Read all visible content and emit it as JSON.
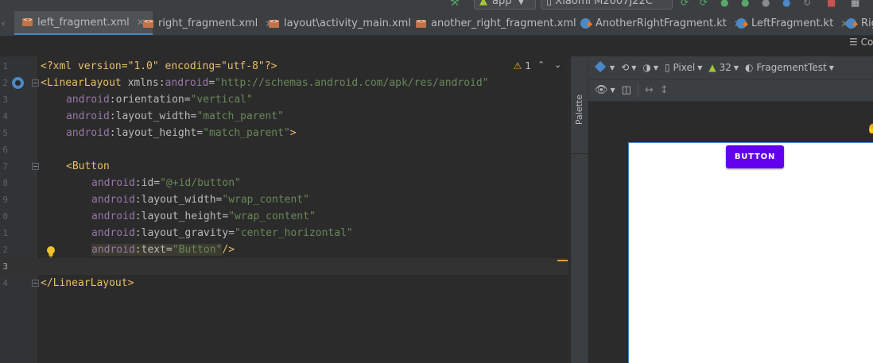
{
  "toolbar": {
    "run_config": "app",
    "device": "Xiaomi M2007J22C"
  },
  "tabs": [
    {
      "label": "left_fragment.xml",
      "type": "xml",
      "active": true
    },
    {
      "label": "right_fragment.xml",
      "type": "xml",
      "active": false
    },
    {
      "label": "layout\\activity_main.xml",
      "type": "xml",
      "active": false
    },
    {
      "label": "another_right_fragment.xml",
      "type": "xml",
      "active": false
    },
    {
      "label": "AnotherRightFragment.kt",
      "type": "kotlin",
      "active": false
    },
    {
      "label": "LeftFragment.kt",
      "type": "kotlin",
      "active": false
    },
    {
      "label": "Rig",
      "type": "kotlin",
      "active": false
    }
  ],
  "editor": {
    "warnings_count": "1",
    "lines": [
      {
        "num": "1"
      },
      {
        "num": "2"
      },
      {
        "num": "3"
      },
      {
        "num": "4"
      },
      {
        "num": "5"
      },
      {
        "num": "6"
      },
      {
        "num": "7"
      },
      {
        "num": "8"
      },
      {
        "num": "9"
      },
      {
        "num": "0"
      },
      {
        "num": "1"
      },
      {
        "num": "2"
      },
      {
        "num": "3"
      },
      {
        "num": "4"
      }
    ],
    "code": {
      "l1_pi": "<?xml version=\"1.0\" encoding=\"utf-8\"?>",
      "l2_tag": "<LinearLayout",
      "l2_attr": " xmlns:",
      "l2_ns": "android",
      "l2_eq": "=",
      "l2_val": "\"http://schemas.android.com/apk/res/android\"",
      "l3_ns": "android",
      "l3_attr": ":orientation=",
      "l3_val": "\"vertical\"",
      "l4_ns": "android",
      "l4_attr": ":layout_width=",
      "l4_val": "\"match_parent\"",
      "l5_ns": "android",
      "l5_attr": ":layout_height=",
      "l5_val": "\"match_parent\"",
      "l5_end": ">",
      "l7_tag": "<Button",
      "l8_ns": "android",
      "l8_attr": ":id=",
      "l8_val": "\"@+id/button\"",
      "l9_ns": "android",
      "l9_attr": ":layout_width=",
      "l9_val": "\"wrap_content\"",
      "l10_ns": "android",
      "l10_attr": ":layout_height=",
      "l10_val": "\"wrap_content\"",
      "l11_ns": "android",
      "l11_attr": ":layout_gravity=",
      "l11_val": "\"center_horizontal\"",
      "l12_ns": "android",
      "l12_attr": ":text=",
      "l12_val": "\"Button\"",
      "l12_end": "/>",
      "l14_tag": "</LinearLayout>"
    }
  },
  "design": {
    "palette_label": "Palette",
    "device_label": "Pixel",
    "api_label": "32",
    "theme_label": "FragementTest",
    "preview_button_label": "BUTTON",
    "preview_button_color": "#6200ee",
    "overflow_label": "Co"
  }
}
